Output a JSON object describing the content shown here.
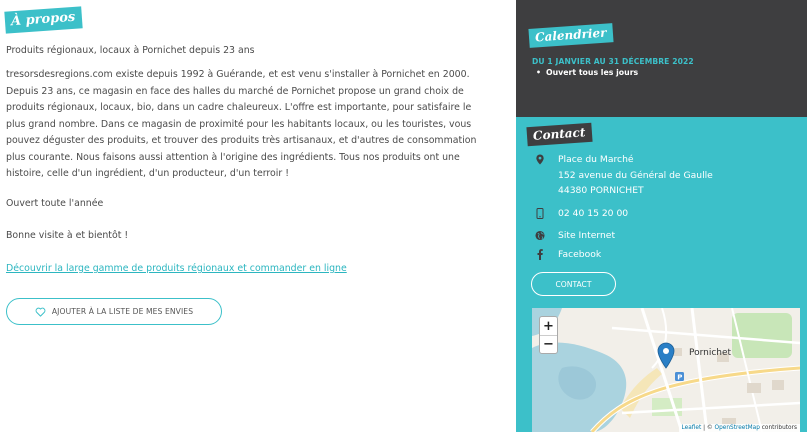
{
  "about": {
    "title": "À propos",
    "subtitle": "Produits régionaux, locaux à Pornichet depuis 23 ans",
    "body": "tresorsdesregions.com existe depuis 1992 à Guérande, et est venu s'installer à Pornichet en 2000. Depuis 23 ans, ce magasin en face des halles du marché de Pornichet propose un grand choix de produits régionaux, locaux, bio, dans un cadre chaleureux. L'offre est importante, pour satisfaire le plus grand nombre. Dans ce magasin de proximité pour les habitants locaux, ou les touristes, vous pouvez déguster des produits, et trouver des produits très artisanaux, et d'autres de consommation plus courante. Nous faisons aussi attention à l'origine des ingrédients. Tous nos produits ont une histoire, celle d'un ingrédient, d'un producteur, d'un terroir !",
    "open": "Ouvert toute l'année",
    "greeting": "Bonne visite à et bientôt !",
    "link": "Découvrir la large gamme de produits régionaux et commander en ligne",
    "wishlist_button": "AJOUTER À LA LISTE DE MES ENVIES"
  },
  "calendar": {
    "title": "Calendrier",
    "date_range": "DU 1 JANVIER AU 31 DÉCEMBRE 2022",
    "item": "Ouvert tous les jours"
  },
  "contact": {
    "title": "Contact",
    "address_line1": "Place du Marché",
    "address_line2": "152 avenue du Général de Gaulle",
    "address_line3": "44380 PORNICHET",
    "phone": "02 40 15 20 00",
    "website": "Site Internet",
    "facebook": "Facebook",
    "button": "CONTACT"
  },
  "map": {
    "zoom_in": "+",
    "zoom_out": "−",
    "place_label": "Pornichet",
    "attribution_leaflet": "Leaflet",
    "attribution_sep": " | © ",
    "attribution_osm": "OpenStreetMap",
    "attribution_rest": " contributors"
  },
  "colors": {
    "accent": "#3cc0c9",
    "dark": "#3e3e40"
  }
}
